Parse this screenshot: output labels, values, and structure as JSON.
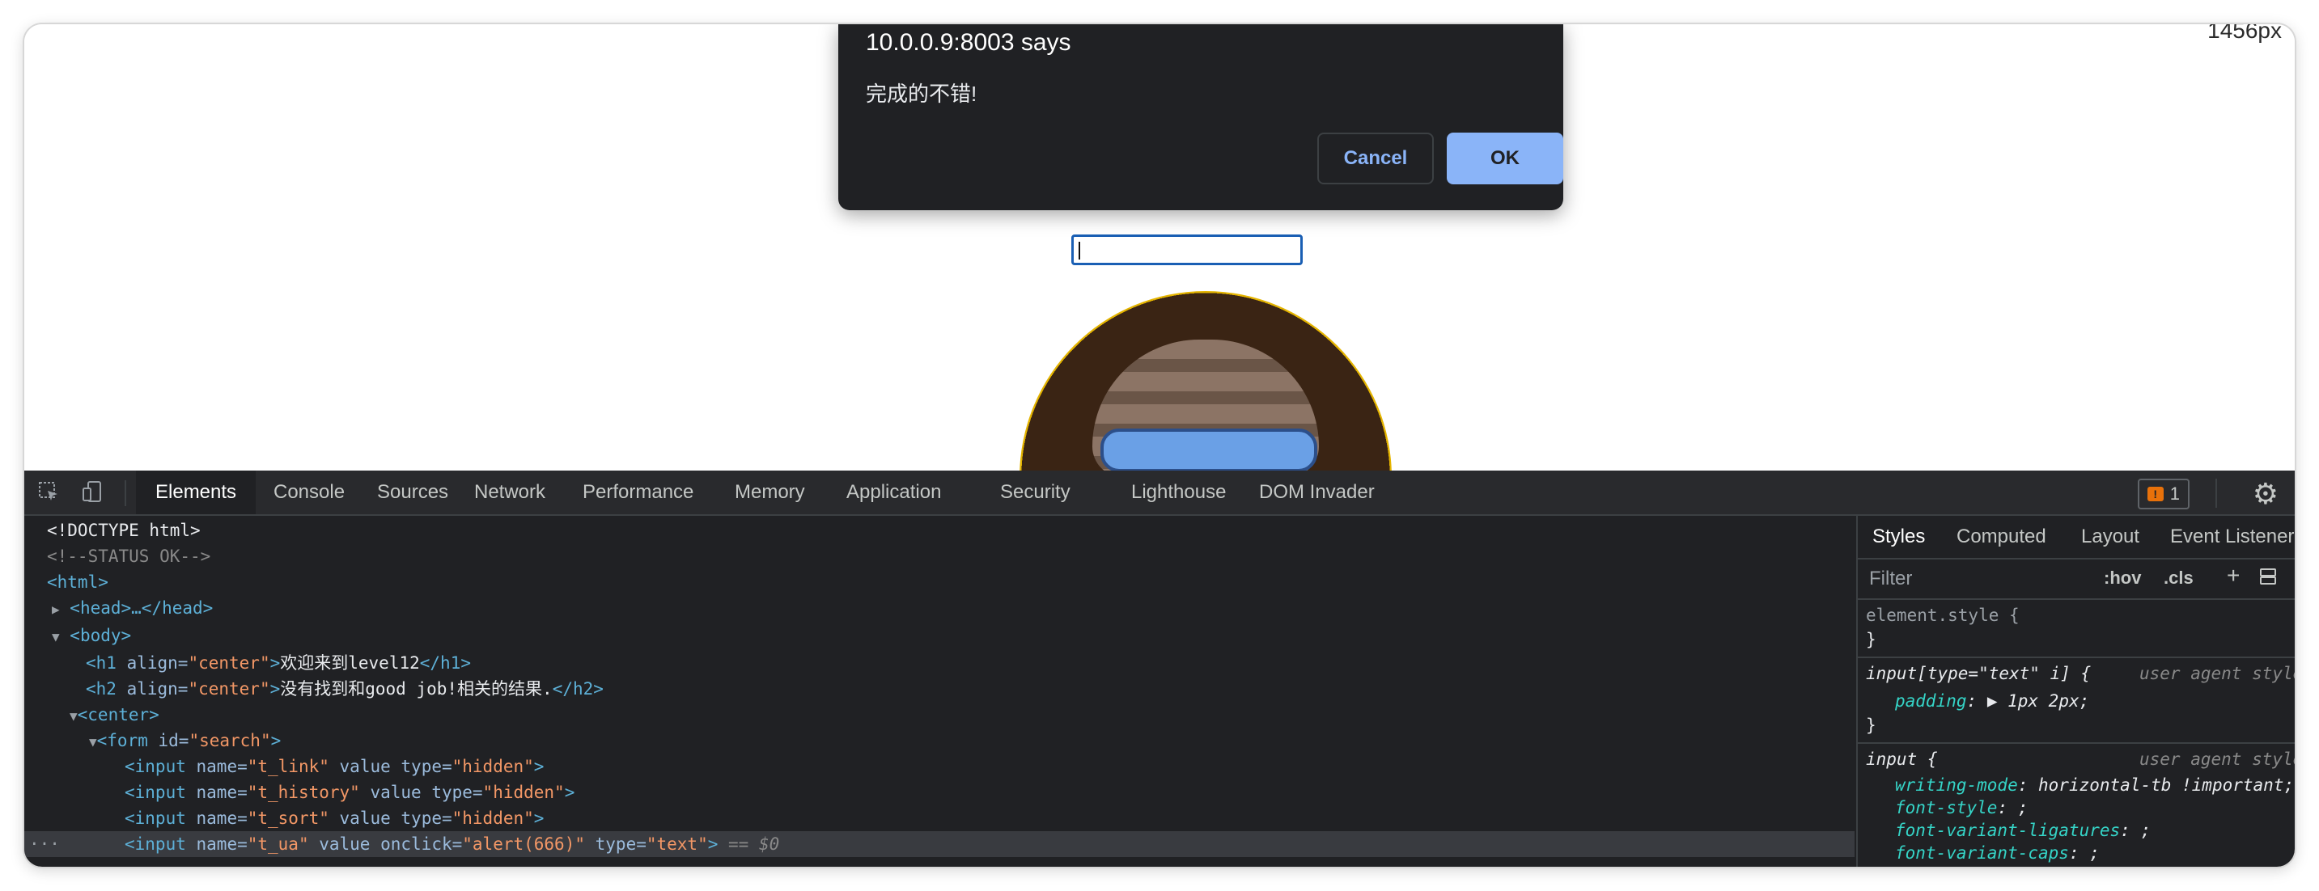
{
  "viewport": {
    "size_indicator": "1456px"
  },
  "dialog": {
    "title": "10.0.0.9:8003 says",
    "message": "完成的不错!",
    "cancel_label": "Cancel",
    "ok_label": "OK"
  },
  "devtools": {
    "tabs": [
      "Elements",
      "Console",
      "Sources",
      "Network",
      "Performance",
      "Memory",
      "Application",
      "Security",
      "Lighthouse",
      "DOM Invader"
    ],
    "active_tab": "Elements",
    "issues_count": "1",
    "issues_icon": "!",
    "icons": [
      "inspect-icon",
      "device-toolbar-icon",
      "issues-icon",
      "gear-icon"
    ]
  },
  "elements": {
    "lines": {
      "doctype": "<!DOCTYPE html>",
      "comment": "<!--STATUS OK-->",
      "html_open": "<html>",
      "head": "<head>…</head>",
      "body_open": "<body>",
      "h1_open": "<h1 ",
      "h1_attr": "align=",
      "h1_val": "\"center\"",
      "h1_text": "欢迎来到level12",
      "h1_close": "</h1>",
      "h2_open": "<h2 ",
      "h2_attr": "align=",
      "h2_val": "\"center\"",
      "h2_text": "没有找到和good job!相关的结果.",
      "h2_close": "</h2>",
      "center_open": "<center>",
      "form_open": "<form ",
      "form_attr": "id=",
      "form_val": "\"search\"",
      "form_end": ">",
      "input1_name_val": "\"t_link\"",
      "input2_name_val": "\"t_history\"",
      "input3_name_val": "\"t_sort\"",
      "input4_name_val": "\"t_ua\"",
      "input4_onclick_val": "\"alert(666)\"",
      "input4_type_val": "\"text\"",
      "hidden_val": "\"hidden\"",
      "input_open": "<input ",
      "name_attr": "name=",
      "value_attr": " value ",
      "type_attr": "type=",
      "onclick_attr": "onclick=",
      "tag_end": ">",
      "selected_ref": " == $0",
      "dots": "···"
    }
  },
  "styles": {
    "tabs": [
      "Styles",
      "Computed",
      "Layout",
      "Event Listeners"
    ],
    "active_tab": "Styles",
    "filter_placeholder": "Filter",
    "hov": ":hov",
    "cls": ".cls",
    "plus": "+",
    "element_style": "element.style {",
    "close_brace": "}",
    "rule1_selector": "input[type=\"text\" i] {",
    "rule1_source": "user agent stylesheet",
    "rule1_prop": "padding",
    "rule1_value": "▶ 1px 2px;",
    "rule2_selector": "input {",
    "rule2_source": "user agent stylesheet",
    "rule2_props": [
      {
        "prop": "writing-mode",
        "value": " horizontal-tb !important;"
      },
      {
        "prop": "font-style",
        "value": " ;"
      },
      {
        "prop": "font-variant-ligatures",
        "value": " ;"
      },
      {
        "prop": "font-variant-caps",
        "value": " ;"
      }
    ]
  }
}
